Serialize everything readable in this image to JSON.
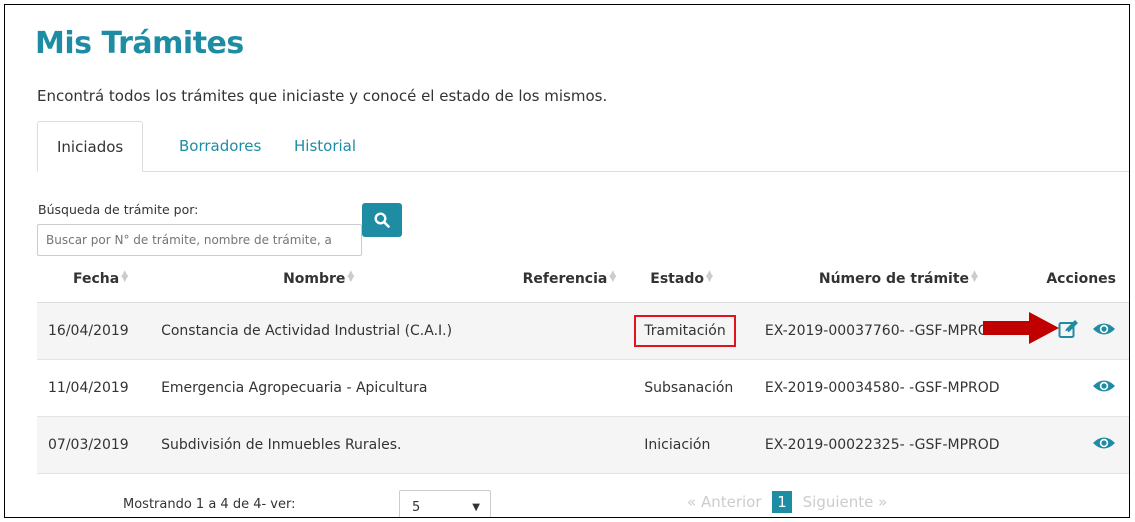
{
  "page": {
    "title": "Mis Trámites",
    "subtitle": "Encontrá todos los trámites que iniciaste y conocé el estado de los mismos."
  },
  "tabs": [
    {
      "label": "Iniciados",
      "active": true
    },
    {
      "label": "Borradores",
      "active": false
    },
    {
      "label": "Historial",
      "active": false
    }
  ],
  "search": {
    "label": "Búsqueda de trámite por:",
    "placeholder": "Buscar por N° de trámite, nombre de trámite, a",
    "button_icon": "search-icon"
  },
  "table": {
    "headers": {
      "fecha": "Fecha",
      "nombre": "Nombre",
      "referencia": "Referencia",
      "estado": "Estado",
      "numero": "Número de trámite",
      "acciones": "Acciones"
    },
    "rows": [
      {
        "fecha": "16/04/2019",
        "nombre": "Constancia de Actividad Industrial (C.A.I.)",
        "referencia": "",
        "estado": "Tramitación",
        "numero": "EX-2019-00037760- -GSF-MPROD",
        "actions": [
          "edit-icon",
          "eye-icon"
        ]
      },
      {
        "fecha": "11/04/2019",
        "nombre": "Emergencia Agropecuaria - Apicultura",
        "referencia": "",
        "estado": "Subsanación",
        "numero": "EX-2019-00034580- -GSF-MPROD",
        "actions": [
          "eye-icon"
        ]
      },
      {
        "fecha": "07/03/2019",
        "nombre": "Subdivisión de Inmuebles Rurales.",
        "referencia": "",
        "estado": "Iniciación",
        "numero": "EX-2019-00022325- -GSF-MPROD",
        "actions": [
          "eye-icon"
        ]
      }
    ]
  },
  "footer": {
    "showing": "Mostrando 1 a 4 de 4- ver:",
    "page_size": "5",
    "prev": "« Anterior",
    "current_page": "1",
    "next": "Siguiente »"
  },
  "colors": {
    "accent": "#1e8ca3",
    "highlight": "#e0141e",
    "arrow": "#c00000"
  }
}
